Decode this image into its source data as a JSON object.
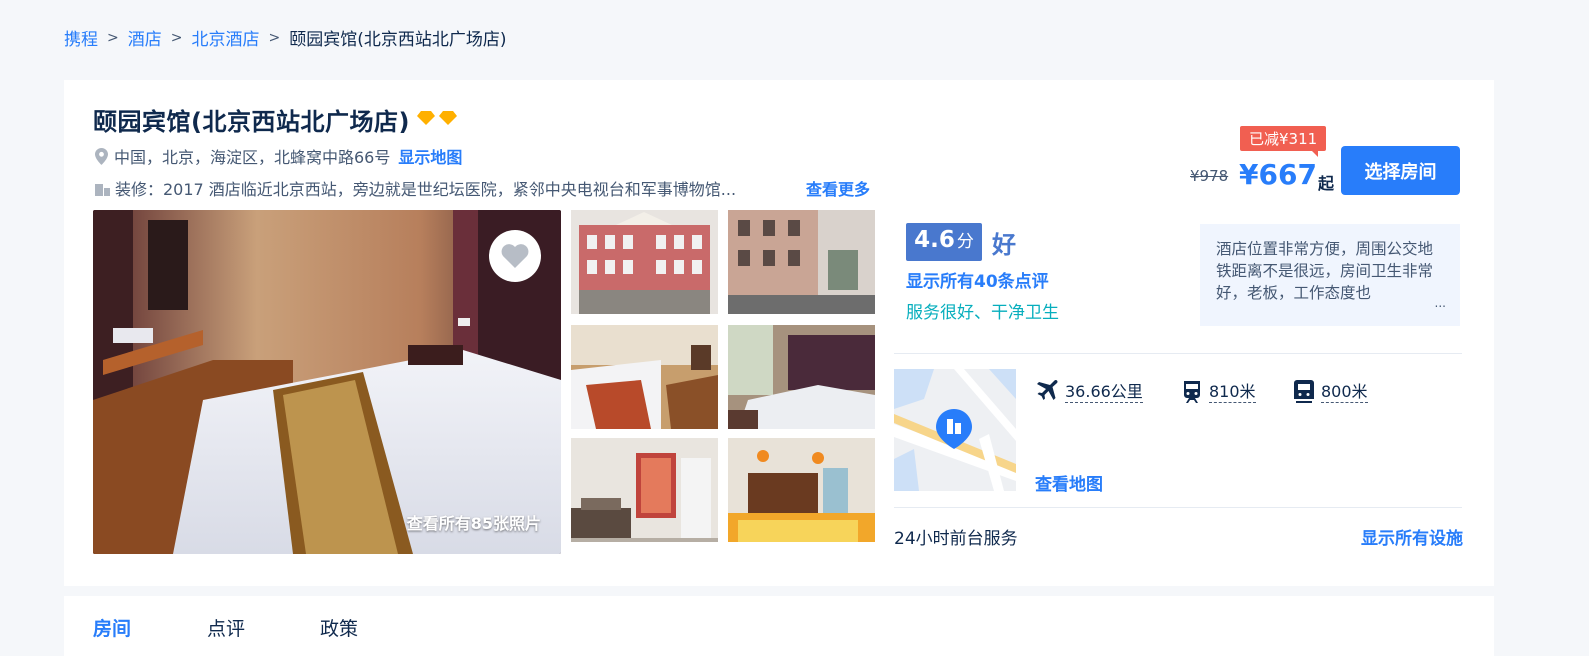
{
  "breadcrumb": {
    "items": [
      "携程",
      "酒店",
      "北京酒店"
    ],
    "current": "颐园宾馆(北京西站北广场店)"
  },
  "hotel": {
    "name": "颐园宾馆(北京西站北广场店)",
    "diamond_color": "#ffb000",
    "address": "中国，北京，海淀区，北蜂窝中路66号",
    "show_map_label": "显示地图",
    "description": "装修：2017  酒店临近北京西站，旁边就是世纪坛医院，紧邻中央电视台和军事博物馆...",
    "see_more_label": "查看更多"
  },
  "price": {
    "discount": "已减¥311",
    "original": "¥978",
    "current": "¥667",
    "suffix": "起",
    "select_button": "选择房间"
  },
  "photos": {
    "view_all_label": "查看所有85张照片"
  },
  "rating": {
    "score": "4.6",
    "unit": "分",
    "word": "好",
    "reviews_link": "显示所有40条点评",
    "tags": "服务很好、干净卫生",
    "review_excerpt": "酒店位置非常方便，周围公交地铁距离不是很远，房间卫生非常好，老板，工作态度也",
    "more_symbol": "..."
  },
  "location": {
    "airport_distance": "36.66公里",
    "train_distance": "810米",
    "metro_distance": "800米",
    "map_link": "查看地图"
  },
  "facilities": {
    "highlight": "24小时前台服务",
    "show_all_label": "显示所有设施"
  },
  "tabs": [
    "房间",
    "点评",
    "政策"
  ],
  "colors": {
    "accent": "#287dfa",
    "score": "#4978ce",
    "discount": "#f15f51",
    "tag": "#06aebd"
  }
}
